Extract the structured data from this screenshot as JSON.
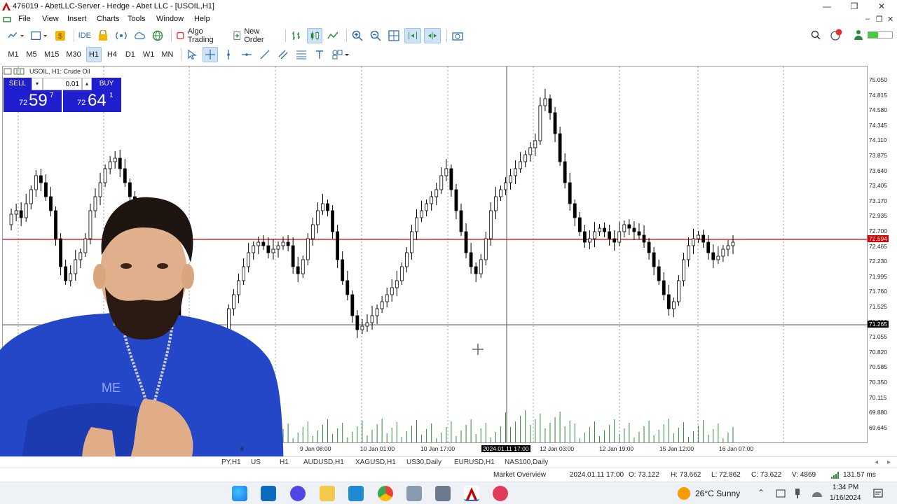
{
  "window": {
    "title": "476019 - AbetLLC-Server - Hedge - Abet LLC - [USOIL,H1]",
    "minimize": "—",
    "maximize": "❐",
    "close": "✕"
  },
  "menu": [
    "File",
    "View",
    "Insert",
    "Charts",
    "Tools",
    "Window",
    "Help"
  ],
  "toolbar": {
    "ide": "IDE",
    "algo_trading": "Algo Trading",
    "new_order": "New Order"
  },
  "timeframes": [
    "M1",
    "M5",
    "M15",
    "M30",
    "H1",
    "H4",
    "D1",
    "W1",
    "MN"
  ],
  "active_timeframe": "H1",
  "chart_header": "USOIL, H1:  Crude Oil",
  "trade_panel": {
    "sell_label": "SELL",
    "buy_label": "BUY",
    "lot": "0.01",
    "sell_prefix": "72",
    "sell_big": "59",
    "sell_sup": "7",
    "buy_prefix": "72",
    "buy_big": "64",
    "buy_sup": "1"
  },
  "price_axis": [
    "75.050",
    "74.815",
    "74.580",
    "74.345",
    "74.110",
    "73.875",
    "73.640",
    "73.405",
    "73.170",
    "72.935",
    "72.700",
    "72.465",
    "72.230",
    "71.995",
    "71.760",
    "71.525",
    "71.290",
    "71.055",
    "70.820",
    "70.585",
    "70.350",
    "70.115",
    "69.880",
    "69.645"
  ],
  "bid_tag": "72.594",
  "cross_tag": "71.265",
  "time_axis": [
    "8",
    "9 Jan 08:00",
    "10 Jan 01:00",
    "10 Jan 17:00",
    "2024.01.11 17:00",
    "12 Jan 03:00",
    "12 Jan 19:00",
    "15 Jan 12:00",
    "16 Jan 07:00"
  ],
  "tabs": [
    "PY,H1",
    "US",
    "H1",
    "AUDUSD,H1",
    "XAGUSD,H1",
    "US30,Daily",
    "EURUSD,H1",
    "NAS100,Daily"
  ],
  "status": {
    "market_overview": "Market Overview",
    "datetime": "2024.01.11 17:00",
    "open": "O: 73.122",
    "high": "H: 73.662",
    "low": "L: 72.862",
    "close": "C: 73.622",
    "volume": "V: 4869",
    "ping": "131.57 ms"
  },
  "taskbar": {
    "weather": "26°C  Sunny",
    "time": "1:34 PM",
    "date": "1/16/2024"
  },
  "colors": {
    "bid_line": "#d40000",
    "sell_buy_panel": "#1f1fcf",
    "candles": "#000000"
  }
}
